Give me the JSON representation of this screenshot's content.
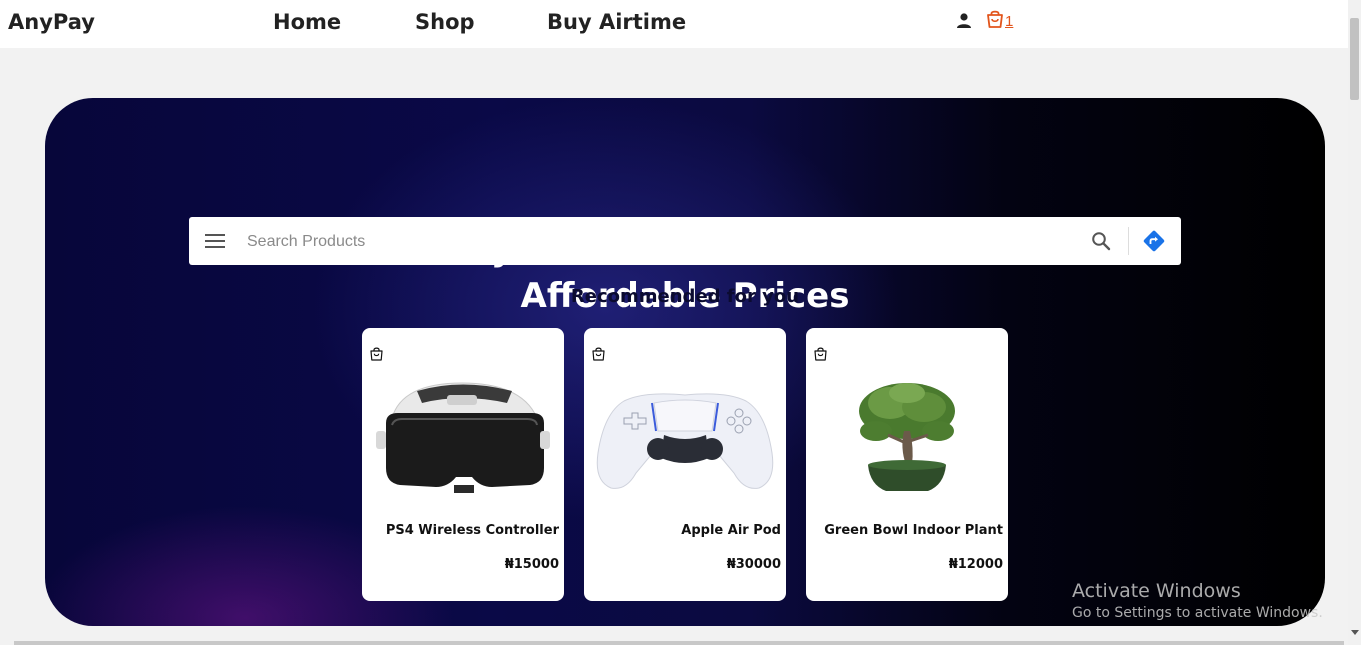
{
  "navbar": {
    "brand": "AnyPay",
    "links": [
      "Home",
      "Shop",
      "Buy Airtime"
    ],
    "cart_count": "1"
  },
  "hero": {
    "title_line1": "Buy The Best Products At",
    "title_line2": "Affordable Prices"
  },
  "search": {
    "placeholder": "Search Products"
  },
  "recommended": {
    "title": "Recommended for you",
    "products": [
      {
        "name": "PS4 Wireless Controller",
        "price": "₦15000",
        "image": "vr-headset"
      },
      {
        "name": "Apple Air Pod",
        "price": "₦30000",
        "image": "game-controller"
      },
      {
        "name": "Green Bowl Indoor Plant",
        "price": "₦12000",
        "image": "bonsai-plant"
      }
    ]
  },
  "watermark": {
    "title": "Activate Windows",
    "subtitle": "Go to Settings to activate Windows."
  },
  "colors": {
    "accent": "#e2551c",
    "hero_dark": "#0a0947",
    "directions_blue": "#1a73e8"
  }
}
